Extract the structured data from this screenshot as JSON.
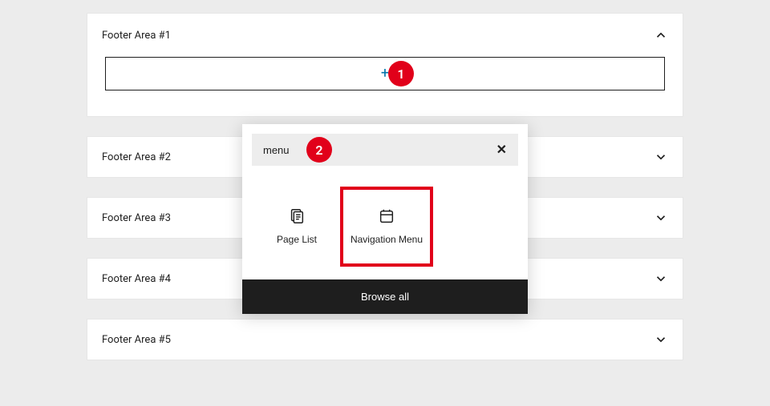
{
  "panels": {
    "expanded": {
      "title": "Footer Area #1"
    },
    "collapsed": [
      {
        "title": "Footer Area #2"
      },
      {
        "title": "Footer Area #3"
      },
      {
        "title": "Footer Area #4"
      },
      {
        "title": "Footer Area #5"
      }
    ]
  },
  "inserter": {
    "search_value": "menu",
    "blocks": {
      "page_list": "Page List",
      "nav_menu": "Navigation Menu"
    },
    "browse_all": "Browse all"
  },
  "markers": {
    "one": "1",
    "two": "2"
  }
}
